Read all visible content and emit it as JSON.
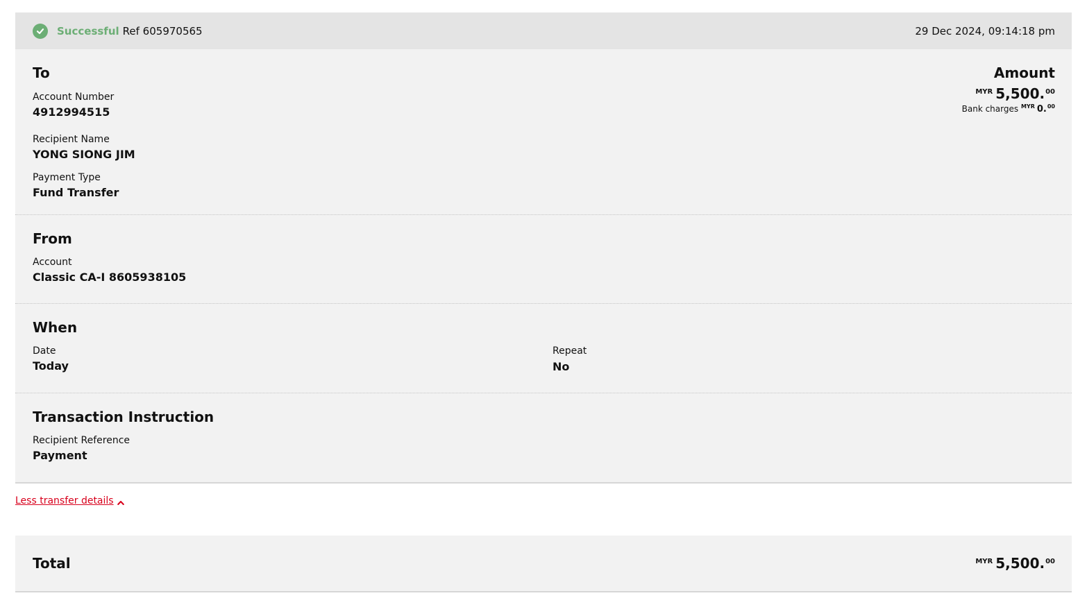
{
  "status": {
    "label": "Successful",
    "ref": "Ref 605970565",
    "timestamp": "29 Dec 2024, 09:14:18 pm",
    "color": "#6cae75"
  },
  "to": {
    "title": "To",
    "account_number_label": "Account Number",
    "account_number": "4912994515",
    "recipient_name_label": "Recipient Name",
    "recipient_name": "YONG SIONG JIM",
    "payment_type_label": "Payment Type",
    "payment_type": "Fund Transfer"
  },
  "amount": {
    "title": "Amount",
    "currency": "MYR",
    "main": "5,500.",
    "cents": "00",
    "bank_charges_label": "Bank charges",
    "bank_charges_currency": "MYR",
    "bank_charges_main": "0.",
    "bank_charges_cents": "00"
  },
  "from": {
    "title": "From",
    "account_label": "Account",
    "account": "Classic CA-I 8605938105"
  },
  "when": {
    "title": "When",
    "date_label": "Date",
    "date": "Today",
    "repeat_label": "Repeat",
    "repeat": "No"
  },
  "instruction": {
    "title": "Transaction Instruction",
    "recipient_reference_label": "Recipient Reference",
    "recipient_reference": "Payment"
  },
  "toggle": {
    "label": "Less transfer details",
    "color": "#d8001c"
  },
  "total": {
    "label": "Total",
    "currency": "MYR",
    "main": "5,500.",
    "cents": "00"
  },
  "icons": {
    "status": "check-circle-icon",
    "toggle": "chevron-up-icon"
  }
}
